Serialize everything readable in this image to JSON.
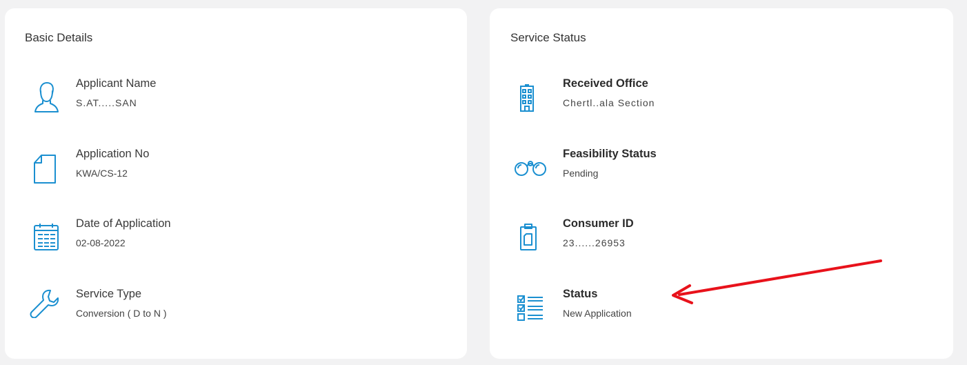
{
  "basic_details": {
    "title": "Basic Details",
    "items": [
      {
        "label": "Applicant Name",
        "value": "S.AT.....SAN",
        "icon": "user-icon"
      },
      {
        "label": "Application No",
        "value": "KWA/CS-12",
        "icon": "document-icon"
      },
      {
        "label": "Date of Application",
        "value": "02-08-2022",
        "icon": "calendar-icon"
      },
      {
        "label": "Service Type",
        "value": "Conversion ( D to N )",
        "icon": "wrench-icon"
      }
    ]
  },
  "service_status": {
    "title": "Service Status",
    "items": [
      {
        "label": "Received Office",
        "value": "Chertl..ala Section",
        "icon": "building-icon"
      },
      {
        "label": "Feasibility Status",
        "value": "Pending",
        "icon": "binoculars-icon"
      },
      {
        "label": "Consumer ID",
        "value": "23......26953",
        "icon": "clipboard-icon"
      },
      {
        "label": "Status",
        "value": "New Application",
        "icon": "checklist-icon"
      }
    ]
  },
  "colors": {
    "icon": "#1a8fd0",
    "annotation_arrow": "#e8121b",
    "card_bg": "#ffffff",
    "page_bg": "#f2f2f3"
  }
}
